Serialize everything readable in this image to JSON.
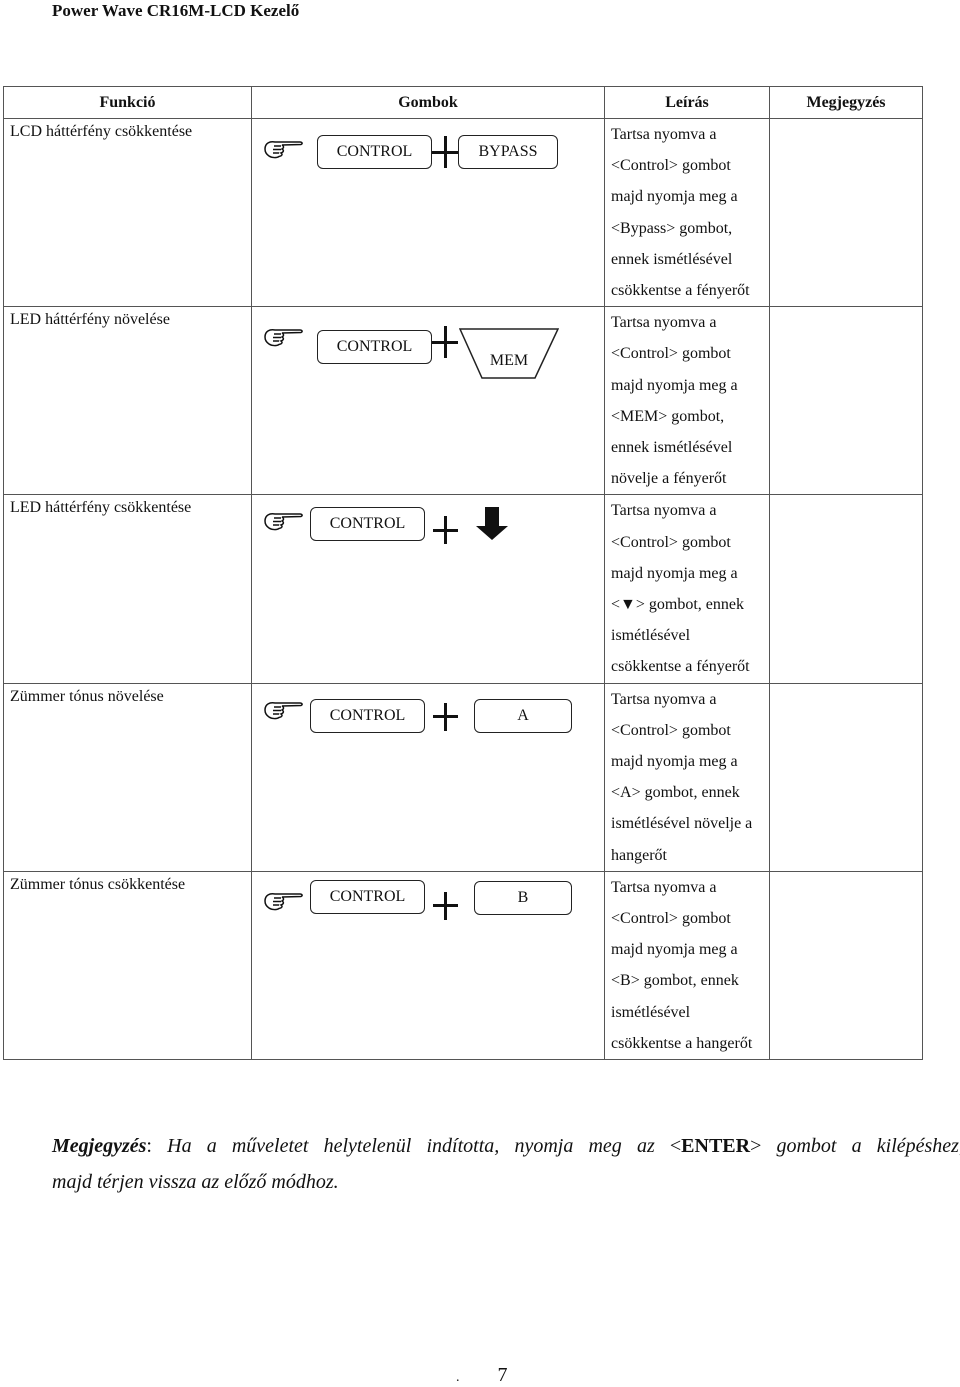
{
  "document": {
    "title": "Power Wave CR16M-LCD Kezelő",
    "page_number": "7",
    "page_prefix": "."
  },
  "table": {
    "headers": [
      "Funkció",
      "Gombok",
      "Leírás",
      "Megjegyzés"
    ],
    "rows": [
      {
        "function": "LCD háttérfény csökkentése",
        "buttons": {
          "first": "CONTROL",
          "operator": "+",
          "second": "BYPASS",
          "second_shape": "rounded-rect"
        },
        "description": [
          "Tartsa nyomva a",
          "<Control> gombot",
          "majd nyomja meg a",
          "<Bypass> gombot,",
          "ennek ismétlésével",
          "csökkentse a fényerőt"
        ],
        "note": ""
      },
      {
        "function": "LED háttérfény növelése",
        "buttons": {
          "first": "CONTROL",
          "operator": "+",
          "second": "MEM",
          "second_shape": "trapezoid"
        },
        "description": [
          "Tartsa nyomva a",
          "<Control> gombot",
          "majd nyomja meg a",
          "<MEM> gombot,",
          "ennek ismétlésével",
          "növelje a fényerőt"
        ],
        "note": ""
      },
      {
        "function": "LED háttérfény csökkentése",
        "buttons": {
          "first": "CONTROL",
          "operator": "+",
          "second": "down-arrow",
          "second_shape": "arrow"
        },
        "description": [
          "Tartsa nyomva a",
          "<Control> gombot",
          "majd nyomja meg a",
          "<▼> gombot, ennek",
          "ismétlésével",
          "csökkentse a fényerőt"
        ],
        "note": ""
      },
      {
        "function": "Zümmer tónus növelése",
        "buttons": {
          "first": "CONTROL",
          "operator": "+",
          "second": "A",
          "second_shape": "rounded-rect"
        },
        "description": [
          "Tartsa nyomva a",
          "<Control> gombot",
          "majd nyomja meg a",
          "<A> gombot, ennek",
          "ismétlésével növelje a",
          "hangerőt"
        ],
        "note": ""
      },
      {
        "function": "Zümmer tónus csökkentése",
        "buttons": {
          "first": "CONTROL",
          "operator": "+",
          "second": "B",
          "second_shape": "rounded-rect"
        },
        "description": [
          "Tartsa nyomva a",
          "<Control> gombot",
          "majd nyomja meg a",
          "<B> gombot, ennek",
          "ismétlésével",
          "csökkentse a hangerőt"
        ],
        "note": ""
      }
    ]
  },
  "footnote": {
    "label": "Megjegyzés",
    "colon": ":",
    "line1_words": [
      "Ha",
      "a",
      "műveletet",
      "helytelenül",
      "indította,",
      "nyomja",
      "meg",
      "az",
      "<ENTER>",
      "gombot",
      "a",
      "kilépéshez,"
    ],
    "enter_open": "<",
    "enter_key": "ENTER",
    "enter_close": ">",
    "line2": "majd térjen vissza az előző módhoz."
  }
}
